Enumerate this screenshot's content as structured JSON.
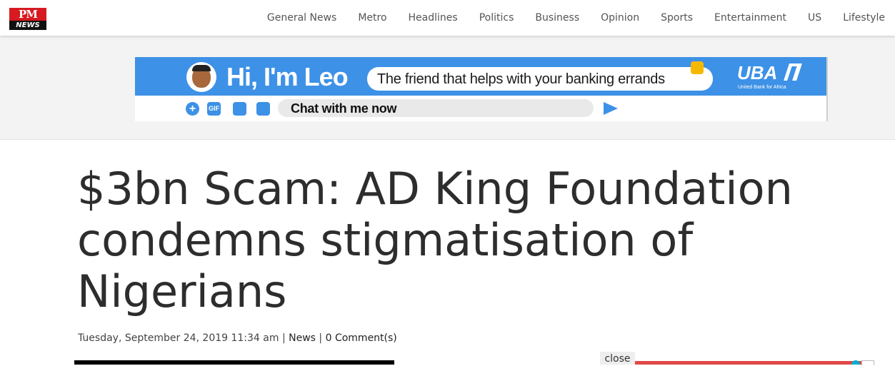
{
  "header": {
    "logo": {
      "pm": "PM",
      "news": "NEWS"
    },
    "nav": [
      "General News",
      "Metro",
      "Headlines",
      "Politics",
      "Business",
      "Opinion",
      "Sports",
      "Entertainment",
      "US",
      "Lifestyle"
    ]
  },
  "ad": {
    "greeting": "Hi, I'm Leo",
    "tagline": "The friend that helps with your banking errands",
    "brand": "UBA",
    "brand_sub": "United Bank for Africa",
    "chat_prompt": "Chat with me now",
    "tools": [
      "+",
      "GIF"
    ],
    "colors": {
      "accent": "#3d91e6"
    }
  },
  "article": {
    "title": "$3bn Scam: AD King Foundation condemns stigmatisation of Nigerians",
    "date": "Tuesday, September 24, 2019 11:34 am",
    "category": "News",
    "comments": "0 Comment(s)",
    "separator": "|"
  },
  "sticky": {
    "close_label": "close"
  }
}
